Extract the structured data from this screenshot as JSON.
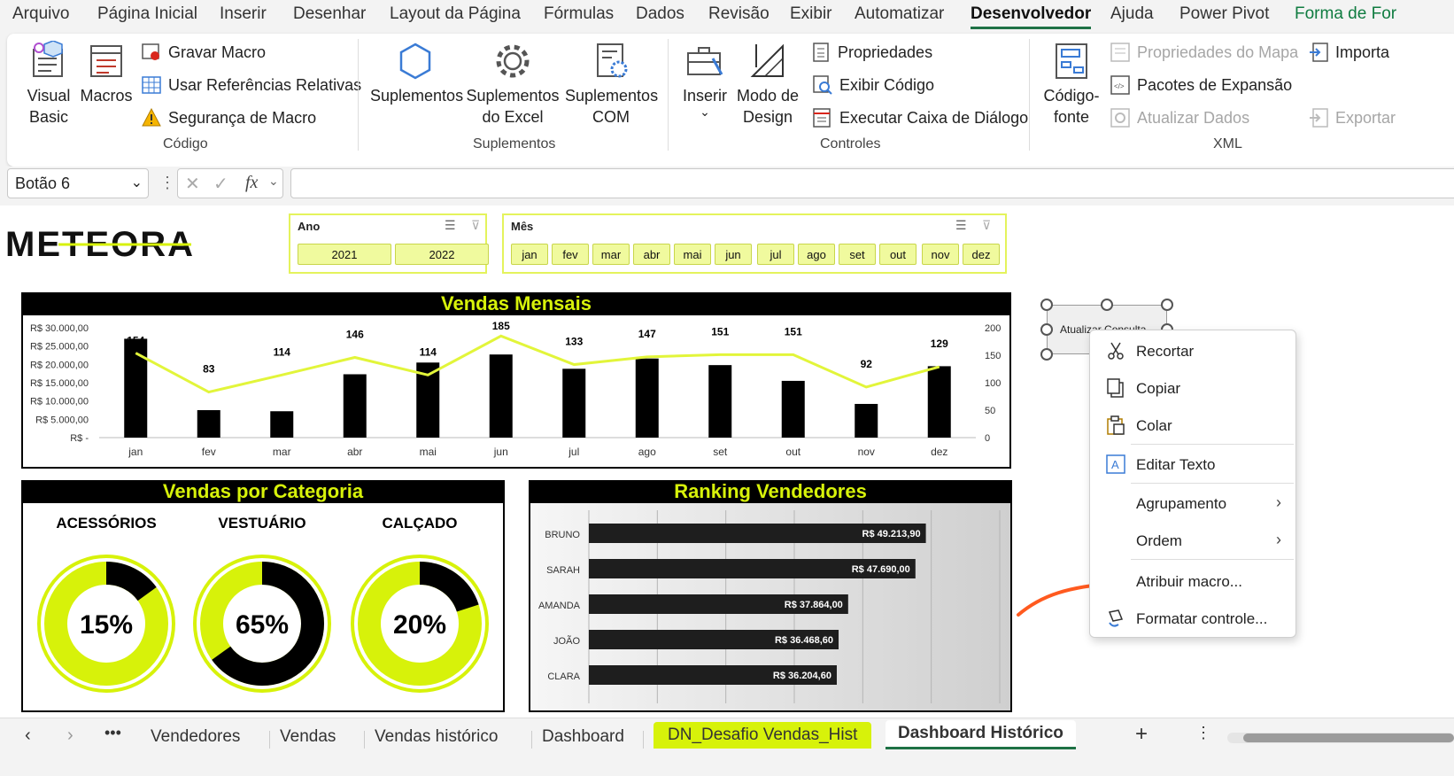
{
  "menu": [
    "Arquivo",
    "Página Inicial",
    "Inserir",
    "Desenhar",
    "Layout da Página",
    "Fórmulas",
    "Dados",
    "Revisão",
    "Exibir",
    "Automatizar",
    "Desenvolvedor",
    "Ajuda",
    "Power Pivot",
    "Forma de For"
  ],
  "active_menu": "Desenvolvedor",
  "ribbon": {
    "codigo": {
      "label": "Código",
      "visual_basic": "Visual\nBasic",
      "macros": "Macros",
      "gravar_macro": "Gravar Macro",
      "usar_referencias": "Usar Referências Relativas",
      "seguranca": "Segurança de Macro"
    },
    "suplementos": {
      "label": "Suplementos",
      "suplementos": "Suplementos",
      "excel": "Suplementos\ndo Excel",
      "com": "Suplementos\nCOM"
    },
    "controles": {
      "label": "Controles",
      "inserir": "Inserir",
      "modo_design": "Modo de\nDesign",
      "propriedades": "Propriedades",
      "exibir_codigo": "Exibir Código",
      "executar": "Executar Caixa de Diálogo"
    },
    "xml": {
      "label": "XML",
      "codigo_fonte": "Código-\nfonte",
      "prop_mapa": "Propriedades do Mapa",
      "pacotes": "Pacotes de Expansão",
      "atualizar": "Atualizar Dados",
      "importar": "Importa",
      "exportar": "Exportar"
    }
  },
  "formula_bar": {
    "name_box": "Botão 6",
    "fx": "fx",
    "value": ""
  },
  "logo_text": "METEORA",
  "slicer_ano": {
    "title": "Ano",
    "items": [
      "2021",
      "2022"
    ]
  },
  "slicer_mes": {
    "title": "Mês",
    "items": [
      "jan",
      "fev",
      "mar",
      "abr",
      "mai",
      "jun",
      "jul",
      "ago",
      "set",
      "out",
      "nov",
      "dez"
    ]
  },
  "chart_data": [
    {
      "type": "bar",
      "title": "Vendas Mensais",
      "categories": [
        "jan",
        "fev",
        "mar",
        "abr",
        "mai",
        "jun",
        "jul",
        "ago",
        "set",
        "out",
        "nov",
        "dez"
      ],
      "series": [
        {
          "values": [
            27000,
            7500,
            7200,
            17300,
            20500,
            22700,
            18800,
            21600,
            19800,
            15500,
            9200,
            19500
          ]
        },
        {
          "type": "line",
          "values": [
            154,
            83,
            114,
            146,
            114,
            185,
            133,
            147,
            151,
            151,
            92,
            129
          ]
        }
      ],
      "y_ticks": [
        "R$ 30.000,00",
        "R$ 25.000,00",
        "R$ 20.000,00",
        "R$ 15.000,00",
        "R$ 10.000,00",
        "R$ 5.000,00",
        "R$ -"
      ],
      "ylim": [
        0,
        30000
      ],
      "y2_ticks": [
        "200",
        "150",
        "100",
        "50",
        "0"
      ],
      "y2lim": [
        0,
        200
      ],
      "colors": {
        "bar": "#000000",
        "line": "#e2f53a"
      }
    },
    {
      "type": "pie",
      "title": "Vendas por Categoria",
      "donuts": [
        {
          "label": "ACESSÓRIOS",
          "percent": 15,
          "display": "15%"
        },
        {
          "label": "VESTUÁRIO",
          "percent": 65,
          "display": "65%"
        },
        {
          "label": "CALÇADO",
          "percent": 20,
          "display": "20%"
        }
      ],
      "colors": {
        "highlight": "#000000",
        "rest": "#d7f20a"
      }
    },
    {
      "type": "bar",
      "title": "Ranking Vendedores",
      "orientation": "horizontal",
      "categories": [
        "BRUNO",
        "SARAH",
        "AMANDA",
        "JOÃO",
        "CLARA"
      ],
      "values": [
        49213.9,
        47690.0,
        37864.0,
        36468.6,
        36204.6
      ],
      "labels": [
        "R$ 49.213,90",
        "R$ 47.690,00",
        "R$ 37.864,00",
        "R$ 36.468,60",
        "R$ 36.204,60"
      ]
    }
  ],
  "shape_button": {
    "text": "Atualizar Consulta"
  },
  "context_menu": {
    "items": [
      "Recortar",
      "Copiar",
      "Colar",
      "Editar Texto",
      "Agrupamento",
      "Ordem",
      "Atribuir macro...",
      "Formatar controle..."
    ]
  },
  "sheet_tabs": [
    "Vendedores",
    "Vendas",
    "Vendas histórico",
    "Dashboard",
    "DN_Desafio Vendas_Hist",
    "Dashboard Histórico"
  ],
  "active_tab": "Dashboard Histórico",
  "colors": {
    "accent": "#d7f20a",
    "excel_green": "#1e7145",
    "annotation": "#ff5a1f"
  }
}
